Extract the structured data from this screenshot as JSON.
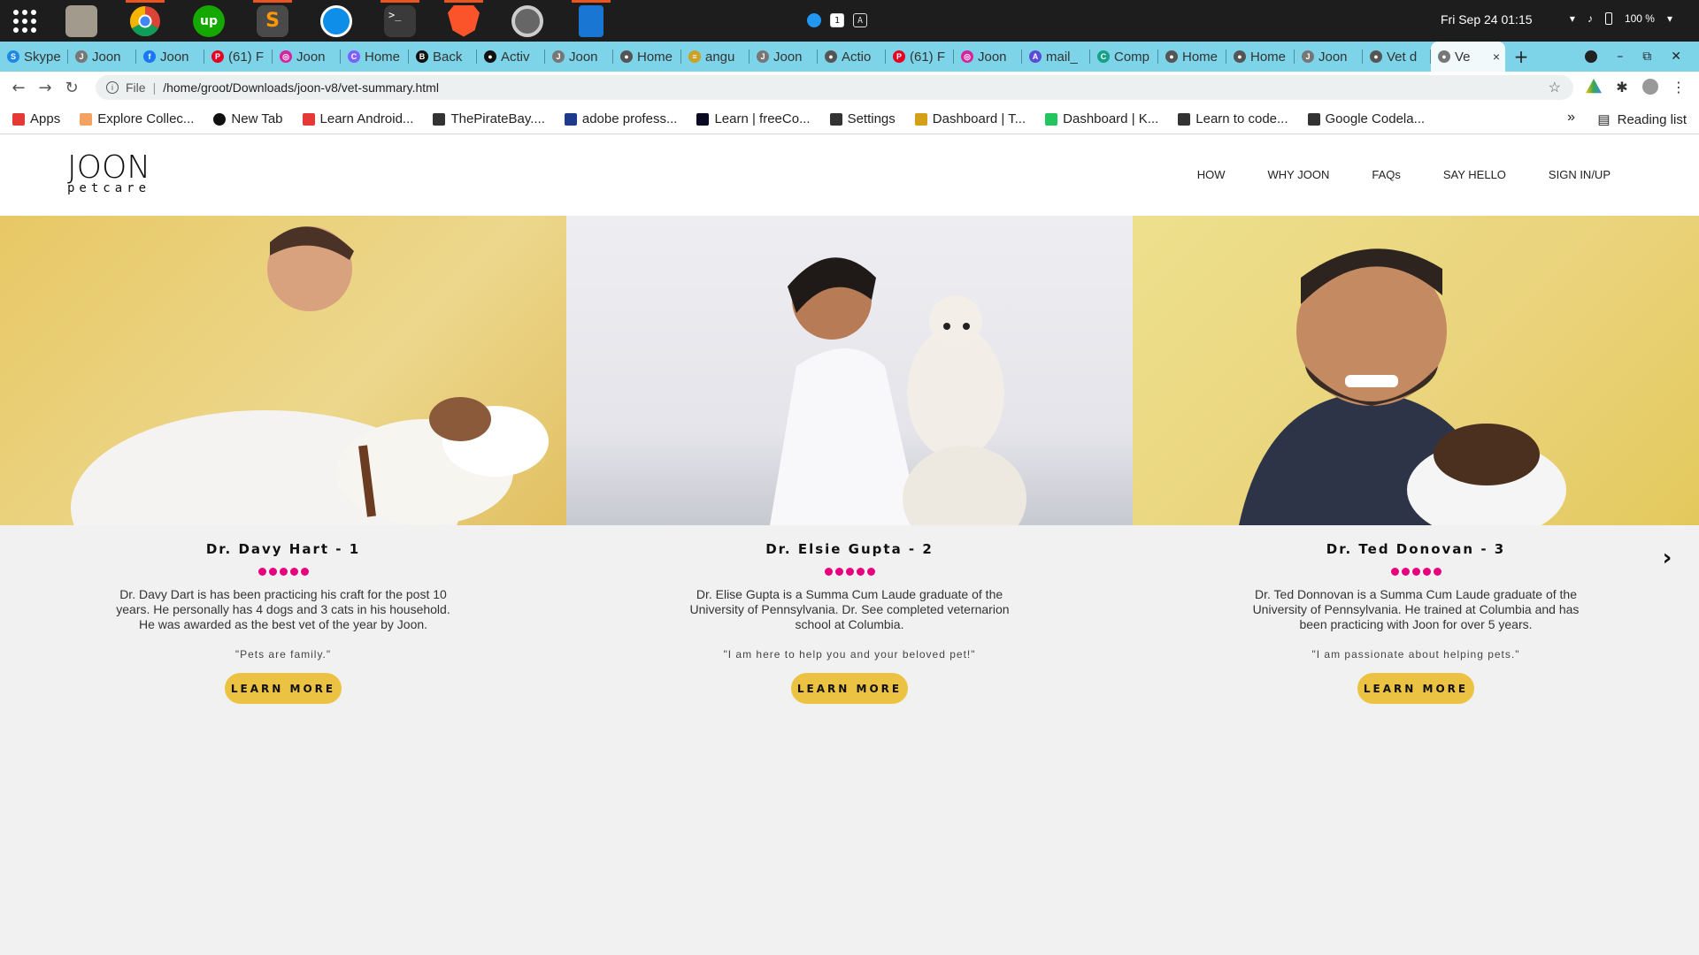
{
  "os": {
    "clock": "Fri Sep 24  01:15",
    "battery": "100 %",
    "tray_sq1": "1",
    "tray_sq2": "A",
    "dock_apps": [
      "files-icon",
      "chrome-icon",
      "upwork-icon",
      "sublime-icon",
      "teamviewer-icon",
      "terminal-icon",
      "brave-icon",
      "settings-icon",
      "writer-icon"
    ]
  },
  "browser": {
    "tabs": [
      {
        "label": "Skype",
        "color": "#1e88e5",
        "glyph": "S"
      },
      {
        "label": "Joon",
        "color": "#777",
        "glyph": "J"
      },
      {
        "label": "Joon",
        "color": "#1877f2",
        "glyph": "f"
      },
      {
        "label": "(61) F",
        "color": "#e60023",
        "glyph": "P"
      },
      {
        "label": "Joon",
        "color": "#d6249f",
        "glyph": "◎"
      },
      {
        "label": "Home",
        "color": "#7b61ff",
        "glyph": "C"
      },
      {
        "label": "Back",
        "color": "#111",
        "glyph": "B"
      },
      {
        "label": "Activ",
        "color": "#111",
        "glyph": "●"
      },
      {
        "label": "Joon",
        "color": "#777",
        "glyph": "J"
      },
      {
        "label": "Home",
        "color": "#555",
        "glyph": "●"
      },
      {
        "label": "angu",
        "color": "#c9a227",
        "glyph": "≡"
      },
      {
        "label": "Joon",
        "color": "#777",
        "glyph": "J"
      },
      {
        "label": "Actio",
        "color": "#555",
        "glyph": "●"
      },
      {
        "label": "(61) F",
        "color": "#e60023",
        "glyph": "P"
      },
      {
        "label": "Joon",
        "color": "#d6249f",
        "glyph": "◎"
      },
      {
        "label": "mail_",
        "color": "#5b4bd6",
        "glyph": "A"
      },
      {
        "label": "Comp",
        "color": "#16a085",
        "glyph": "C"
      },
      {
        "label": "Home",
        "color": "#555",
        "glyph": "●"
      },
      {
        "label": "Home",
        "color": "#555",
        "glyph": "●"
      },
      {
        "label": "Joon",
        "color": "#777",
        "glyph": "J"
      },
      {
        "label": "Vet d",
        "color": "#555",
        "glyph": "●"
      }
    ],
    "active_tab": {
      "label": "Ve",
      "close": "×"
    },
    "new_tab": "+",
    "address": {
      "scheme": "File",
      "url": "/home/groot/Downloads/joon-v8/vet-summary.html"
    },
    "bookmarks": [
      {
        "label": "Apps",
        "color": "#e53935"
      },
      {
        "label": "Explore Collec...",
        "color": "#f4a261"
      },
      {
        "label": "New Tab",
        "color": "#111"
      },
      {
        "label": "Learn Android...",
        "color": "#e53935"
      },
      {
        "label": "ThePirateBay....",
        "color": "#333"
      },
      {
        "label": "adobe profess...",
        "color": "#1e3a8a"
      },
      {
        "label": "Learn | freeCo...",
        "color": "#0a0a23"
      },
      {
        "label": "Settings",
        "color": "#333"
      },
      {
        "label": "Dashboard | T...",
        "color": "#d4a017"
      },
      {
        "label": "Dashboard | K...",
        "color": "#22c55e"
      },
      {
        "label": "Learn to code...",
        "color": "#333"
      },
      {
        "label": "Google Codela...",
        "color": "#333"
      }
    ],
    "more_bookmarks": "»",
    "reading_list": "Reading list"
  },
  "site": {
    "logo_big": "JOON",
    "logo_small": "petcare",
    "nav": [
      "HOW",
      "WHY JOON",
      "FAQs",
      "SAY HELLO",
      "SIGN IN/UP"
    ],
    "vets": [
      {
        "name": "Dr. Davy Hart - 1",
        "rating": 5,
        "bio": "Dr. Davy Dart is has been practicing his craft for the post 10 years. He personally has 4 dogs and 3 cats in his household. He was awarded as the best vet of the year by Joon.",
        "quote": "\"Pets are family.\"",
        "cta": "LEARN MORE",
        "photo_style": "yellow"
      },
      {
        "name": "Dr. Elsie Gupta - 2",
        "rating": 5,
        "bio": "Dr. Elise Gupta is a Summa Cum Laude graduate of the University of Pennsylvania. Dr. See completed veternarion school at Columbia.",
        "quote": "\"I am here to help you and your beloved pet!\"",
        "cta": "LEARN MORE",
        "photo_style": "gray"
      },
      {
        "name": "Dr. Ted Donovan - 3",
        "rating": 5,
        "bio": "Dr. Ted Donnovan is a Summa Cum Laude graduate of the University of Pennsylvania. He trained at Columbia and has been practicing with Joon for over 5 years.",
        "quote": "\"I am passionate about helping pets.\"",
        "cta": "LEARN MORE",
        "photo_style": "yellow2"
      }
    ],
    "next_arrow": "›",
    "accent_pink": "#e6007e",
    "accent_yellow": "#ecc243"
  }
}
